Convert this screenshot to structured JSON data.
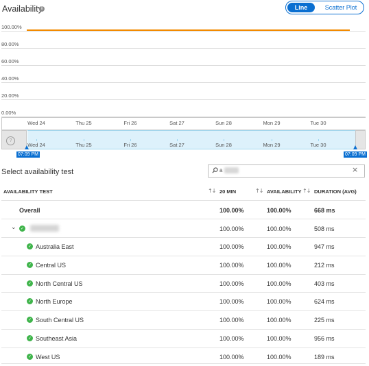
{
  "header": {
    "title": "Availability",
    "info_icon": "info-icon",
    "view_toggle": {
      "line_label": "Line",
      "scatter_label": "Scatter Plot",
      "selected": "Line"
    }
  },
  "chart_data": {
    "type": "line",
    "title": "",
    "yticks": [
      "100.00%",
      "80.00%",
      "60.00%",
      "40.00%",
      "20.00%",
      "0.00%"
    ],
    "ylim": [
      0,
      100
    ],
    "x": [
      "Wed 24",
      "Thu 25",
      "Fri 26",
      "Sat 27",
      "Sun 28",
      "Mon 29",
      "Tue 30"
    ],
    "series": [
      {
        "values": [
          100,
          100,
          100,
          100,
          100,
          100,
          100
        ],
        "color": "#f28a00"
      }
    ],
    "grid": true
  },
  "brush": {
    "ticks": [
      "Wed 24",
      "Thu 25",
      "Fri 26",
      "Sat 27",
      "Sun 28",
      "Mon 29",
      "Tue 30"
    ],
    "start_time": "07:09 PM",
    "end_time": "07:09 PM",
    "accent": "#0a6fd1"
  },
  "select_section": {
    "title": "Select availability test",
    "search_value": "a",
    "search_icon": "search-icon",
    "clear_icon": "close-icon"
  },
  "table": {
    "headers": {
      "test": "AVAILABILITY TEST",
      "twenty_min": "20 MIN",
      "availability": "AVAILABILITY",
      "duration": "DURATION (AVG)"
    },
    "overall": {
      "label": "Overall",
      "twenty_min": "100.00%",
      "availability": "100.00%",
      "duration": "668 ms"
    },
    "group": {
      "twenty_min": "100.00%",
      "availability": "100.00%",
      "duration": "508 ms",
      "expanded": true
    },
    "rows": [
      {
        "label": "Australia East",
        "twenty_min": "100.00%",
        "availability": "100.00%",
        "duration": "947 ms"
      },
      {
        "label": "Central US",
        "twenty_min": "100.00%",
        "availability": "100.00%",
        "duration": "212 ms"
      },
      {
        "label": "North Central US",
        "twenty_min": "100.00%",
        "availability": "100.00%",
        "duration": "403 ms"
      },
      {
        "label": "North Europe",
        "twenty_min": "100.00%",
        "availability": "100.00%",
        "duration": "624 ms"
      },
      {
        "label": "South Central US",
        "twenty_min": "100.00%",
        "availability": "100.00%",
        "duration": "225 ms"
      },
      {
        "label": "Southeast Asia",
        "twenty_min": "100.00%",
        "availability": "100.00%",
        "duration": "956 ms"
      },
      {
        "label": "West US",
        "twenty_min": "100.00%",
        "availability": "100.00%",
        "duration": "189 ms"
      }
    ],
    "status_color": "#3fb44b"
  }
}
